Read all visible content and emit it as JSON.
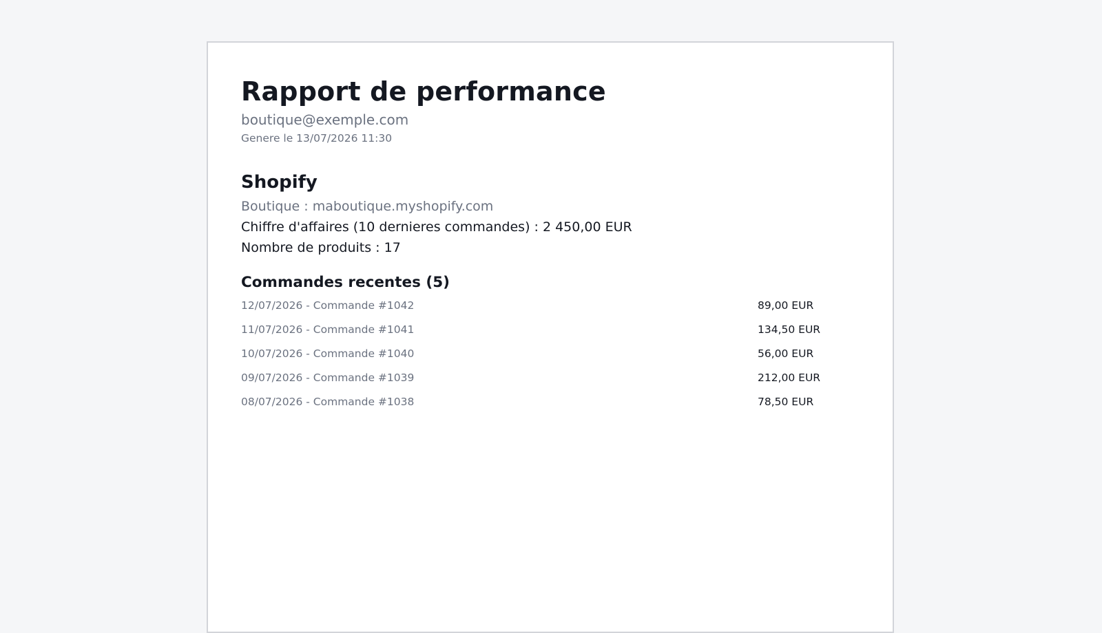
{
  "report": {
    "title": "Rapport de performance",
    "email": "boutique@exemple.com",
    "generated": "Genere le 13/07/2026 11:30"
  },
  "shopify": {
    "section_title": "Shopify",
    "shop": "Boutique : maboutique.myshopify.com",
    "revenue": "Chiffre d'affaires (10 dernieres commandes) : 2 450,00 EUR",
    "products": "Nombre de produits : 17",
    "orders_title": "Commandes recentes (5)",
    "orders": [
      {
        "label": "12/07/2026 - Commande #1042",
        "amount": "89,00 EUR"
      },
      {
        "label": "11/07/2026 - Commande #1041",
        "amount": "134,50 EUR"
      },
      {
        "label": "10/07/2026 - Commande #1040",
        "amount": "56,00 EUR"
      },
      {
        "label": "09/07/2026 - Commande #1039",
        "amount": "212,00 EUR"
      },
      {
        "label": "08/07/2026 - Commande #1038",
        "amount": "78,50 EUR"
      }
    ]
  }
}
